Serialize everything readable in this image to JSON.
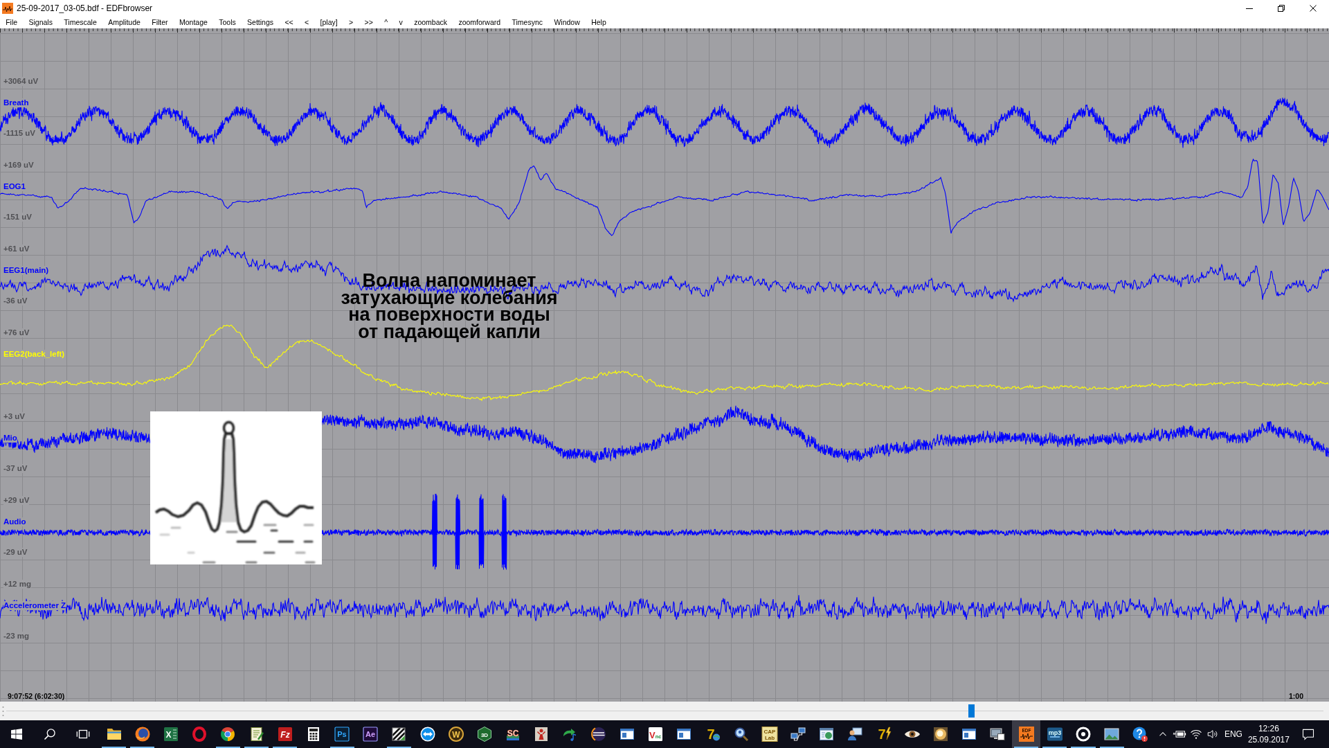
{
  "window": {
    "title": "25-09-2017_03-05.bdf - EDFbrowser",
    "controls": [
      {
        "kind": "minimize"
      },
      {
        "kind": "restore"
      },
      {
        "kind": "close"
      }
    ]
  },
  "menu": [
    "File",
    "Signals",
    "Timescale",
    "Amplitude",
    "Filter",
    "Montage",
    "Tools",
    "Settings",
    "<<",
    "<",
    "[play]",
    ">",
    ">>",
    "^",
    "v",
    "zoomback",
    "zoomforward",
    "Timesync",
    "Window",
    "Help"
  ],
  "channels": [
    {
      "name": "Breath",
      "scale_top": "+3064 uV",
      "scale_bottom": "-1115 uV",
      "color": "#0000ff"
    },
    {
      "name": "EOG1",
      "scale_top": "+169 uV",
      "scale_bottom": "-151 uV",
      "color": "#0000ff"
    },
    {
      "name": "EEG1(main)",
      "scale_top": "+61 uV",
      "scale_bottom": "-36 uV",
      "color": "#0000ff"
    },
    {
      "name": "EEG2(back_left)",
      "scale_top": "+76 uV",
      "color": "#ffff00"
    },
    {
      "name": "Mio",
      "scale_top": "+3 uV",
      "scale_bottom": "-37 uV",
      "color": "#0000ff"
    },
    {
      "name": "Audio",
      "scale_top": "+29 uV",
      "scale_bottom": "-29 uV",
      "color": "#0000ff"
    },
    {
      "name": "Accelerometer Z",
      "scale_top": "+12 mg",
      "scale_bottom": "-23 mg",
      "color": "#0000ff"
    }
  ],
  "annotation": "Волна напоминает\nзатухающие колебания\nна поверхности воды\nот падающей капли",
  "status": {
    "time": "9:07:52 (6:02:30)",
    "timescale": "1:00"
  },
  "position_slider": {
    "level": 0.733
  },
  "taskbar": {
    "system_buttons": [
      {
        "kind": "start"
      },
      {
        "kind": "search"
      },
      {
        "kind": "task_view"
      }
    ],
    "apps": [
      {
        "kind": "folder",
        "running": true,
        "selected": false
      },
      {
        "kind": "fox",
        "running": true,
        "selected": false
      },
      {
        "kind": "sheet",
        "label": "X",
        "running": false,
        "selected": false
      },
      {
        "kind": "ring",
        "running": false,
        "selected": false
      },
      {
        "kind": "wheel",
        "running": true,
        "selected": false
      },
      {
        "kind": "notepad",
        "running": true,
        "selected": false
      },
      {
        "kind": "ftp",
        "label": "Fz",
        "running": true,
        "selected": false
      },
      {
        "kind": "calculator",
        "running": false,
        "selected": false
      },
      {
        "kind": "ps",
        "label": "Ps",
        "running": true,
        "selected": false
      },
      {
        "kind": "ae",
        "label": "Ae",
        "running": false,
        "selected": false
      },
      {
        "kind": "map",
        "running": true,
        "selected": false
      },
      {
        "kind": "remote",
        "running": false,
        "selected": false
      },
      {
        "kind": "disc",
        "label": "W",
        "running": false,
        "selected": false
      },
      {
        "kind": "cube",
        "label": "3D",
        "running": false,
        "selected": false
      },
      {
        "kind": "letters",
        "label": "SC",
        "running": false,
        "selected": false
      },
      {
        "kind": "figure",
        "running": false,
        "selected": false
      },
      {
        "kind": "arrow_note",
        "running": false,
        "selected": false
      },
      {
        "kind": "striped_circle",
        "running": false,
        "selected": false
      },
      {
        "kind": "window",
        "running": false,
        "selected": false
      },
      {
        "kind": "tile_light",
        "label": "Vnc",
        "running": false,
        "selected": false
      },
      {
        "kind": "window",
        "running": false,
        "selected": false
      },
      {
        "kind": "digit_globe",
        "label": "7",
        "running": false,
        "selected": false
      },
      {
        "kind": "magnifier",
        "running": false,
        "selected": false
      },
      {
        "kind": "lab",
        "label": "CAP Lab",
        "running": false,
        "selected": false
      },
      {
        "kind": "network",
        "running": false,
        "selected": false
      },
      {
        "kind": "window_globe",
        "running": false,
        "selected": false
      },
      {
        "kind": "user",
        "running": false,
        "selected": false
      },
      {
        "kind": "digit_bolt",
        "label": "7",
        "running": false,
        "selected": false
      },
      {
        "kind": "eye",
        "running": false,
        "selected": false
      },
      {
        "kind": "orb",
        "running": false,
        "selected": false
      },
      {
        "kind": "window",
        "running": false,
        "selected": false
      },
      {
        "kind": "computer",
        "running": false,
        "selected": false
      },
      {
        "kind": "edf",
        "label": "EDF",
        "running": true,
        "selected": true
      },
      {
        "kind": "mp3",
        "label": "mp3",
        "running": true,
        "selected": false
      },
      {
        "kind": "target",
        "running": true,
        "selected": false
      },
      {
        "kind": "landscape",
        "running": true,
        "selected": false
      },
      {
        "kind": "help",
        "running": false,
        "selected": false
      }
    ],
    "tray": {
      "icons": [
        {
          "kind": "chevron"
        },
        {
          "kind": "battery"
        },
        {
          "kind": "wifi"
        },
        {
          "kind": "volume"
        }
      ],
      "language": "ENG",
      "time": "12:26",
      "date": "25.09.2017",
      "end_icons": [
        {
          "kind": "notification"
        }
      ]
    }
  }
}
